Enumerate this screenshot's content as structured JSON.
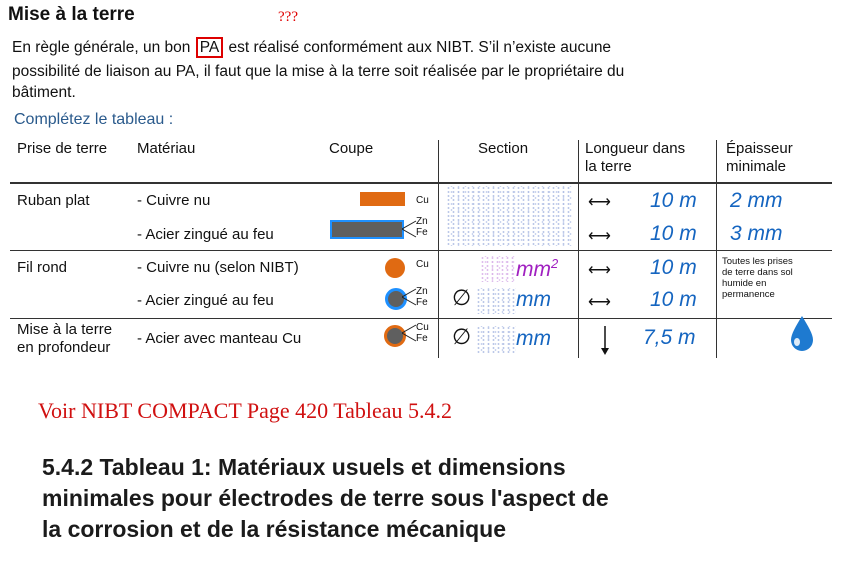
{
  "heading": "Mise à la terre",
  "annotation_marks": "???",
  "paragraph": {
    "line1_before": "En règle générale, un bon ",
    "highlight": "PA",
    "line1_after": " est réalisé conformément aux NIBT. S’il n’existe aucune",
    "line2": "possibilité de liaison au PA, il faut que la mise à la terre soit réalisée par le propriétaire du",
    "line3": "bâtiment."
  },
  "subheading": "Complétez le tableau :",
  "table": {
    "headers": {
      "prise": "Prise de terre",
      "materiau": "Matériau",
      "coupe": "Coupe",
      "section": "Section",
      "longueur_1": "Longueur dans",
      "longueur_2": "la terre",
      "epaisseur_1": "Épaisseur",
      "epaisseur_2": "minimale"
    },
    "rows": [
      {
        "prise": "Ruban plat",
        "materiau": "- Cuivre nu",
        "metal": "Cu",
        "section": "",
        "longueur": "10 m",
        "epaisseur": "2 mm"
      },
      {
        "prise": "",
        "materiau": "- Acier zingué au feu",
        "metal_1": "Zn",
        "metal_2": "Fe",
        "section": "",
        "longueur": "10 m",
        "epaisseur": "3 mm"
      },
      {
        "prise": "Fil rond",
        "materiau": "- Cuivre nu (selon NIBT)",
        "metal": "Cu",
        "section": "mm",
        "section_exp": "2",
        "longueur": "10 m"
      },
      {
        "prise": "",
        "materiau": "- Acier zingué au feu",
        "metal_1": "Zn",
        "metal_2": "Fe",
        "diameter_symbol": "∅",
        "section": "mm",
        "longueur": "10 m"
      },
      {
        "prise_1": "Mise à la terre",
        "prise_2": "en profondeur",
        "materiau": "- Acier avec manteau Cu",
        "metal_1": "Cu",
        "metal_2": "Fe",
        "diameter_symbol": "∅",
        "section": "mm",
        "longueur": "7,5 m"
      }
    ],
    "note_lines": [
      "Toutes les prises",
      "de terre dans sol",
      "humide en",
      "permanence"
    ]
  },
  "reference": "Voir NIBT COMPACT Page 420 Tableau 5.4.2",
  "title_lines": [
    "5.4.2 Tableau 1: Matériaux usuels et dimensions",
    "minimales pour électrodes de terre sous l'aspect de",
    "la corrosion et de la résistance mécanique"
  ],
  "colors": {
    "accent_red": "#d01010",
    "subheading_blue": "#2a5a8c",
    "handwriting_blue": "#1565c0",
    "handwriting_purple": "#a020c0",
    "copper": "#e06a12",
    "steel": "#5f5f5f",
    "zinc_outline": "#1e90ff",
    "drop": "#1e7ad0"
  },
  "icons": [
    "double-arrow-icon",
    "down-arrow-icon",
    "water-drop-icon"
  ]
}
